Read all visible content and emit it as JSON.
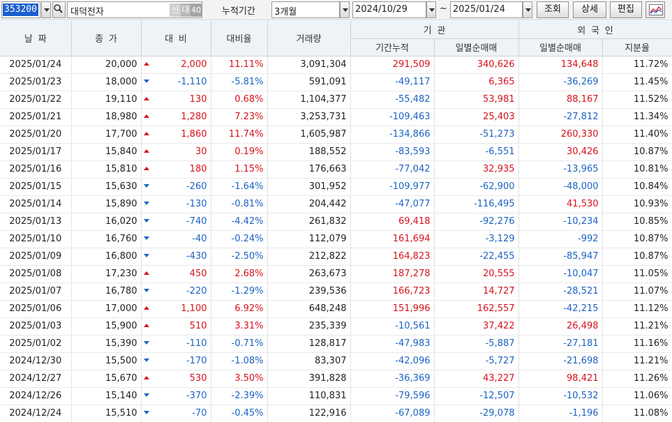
{
  "toolbar": {
    "stock_code": "353200",
    "stock_name": "대덕전자",
    "badge_shin": "신",
    "badge_dae": "대",
    "badge_num": "40",
    "period_label": "누적기간",
    "period_value": "3개월",
    "date_from": "2024/10/29",
    "tilde": "~",
    "date_to": "2025/01/24",
    "search_label": "조회",
    "detail_label": "상세",
    "edit_label": "편집",
    "icons": {
      "search": "magnifier-icon",
      "dropdown": "chevron-down-icon",
      "chart": "line-chart-icon"
    }
  },
  "headers": {
    "date": "날짜",
    "close": "종가",
    "change": "대비",
    "rate": "대비율",
    "volume": "거래량",
    "institution": "기관",
    "inst_cum": "기간누적",
    "inst_daily": "일별순매매",
    "foreign": "외국인",
    "for_daily": "일별순매매",
    "for_share": "지분율"
  },
  "colors": {
    "up": "#d6131c",
    "down": "#1c63c2",
    "header_bg": "#eef3f8",
    "selection": "#1a5fd0"
  },
  "rows": [
    {
      "date": "2025/01/24",
      "close": "20,000",
      "dir": "up",
      "change": "2,000",
      "rate": "11.11%",
      "volume": "3,091,304",
      "inst_cum": "291,509",
      "inst_daily": "340,626",
      "for_daily": "134,648",
      "share": "11.72%"
    },
    {
      "date": "2025/01/23",
      "close": "18,000",
      "dir": "down",
      "change": "-1,110",
      "rate": "-5.81%",
      "volume": "591,091",
      "inst_cum": "-49,117",
      "inst_daily": "6,365",
      "for_daily": "-36,269",
      "share": "11.45%"
    },
    {
      "date": "2025/01/22",
      "close": "19,110",
      "dir": "up",
      "change": "130",
      "rate": "0.68%",
      "volume": "1,104,377",
      "inst_cum": "-55,482",
      "inst_daily": "53,981",
      "for_daily": "88,167",
      "share": "11.52%"
    },
    {
      "date": "2025/01/21",
      "close": "18,980",
      "dir": "up",
      "change": "1,280",
      "rate": "7.23%",
      "volume": "3,253,731",
      "inst_cum": "-109,463",
      "inst_daily": "25,403",
      "for_daily": "-27,812",
      "share": "11.34%"
    },
    {
      "date": "2025/01/20",
      "close": "17,700",
      "dir": "up",
      "change": "1,860",
      "rate": "11.74%",
      "volume": "1,605,987",
      "inst_cum": "-134,866",
      "inst_daily": "-51,273",
      "for_daily": "260,330",
      "share": "11.40%"
    },
    {
      "date": "2025/01/17",
      "close": "15,840",
      "dir": "up",
      "change": "30",
      "rate": "0.19%",
      "volume": "188,552",
      "inst_cum": "-83,593",
      "inst_daily": "-6,551",
      "for_daily": "30,426",
      "share": "10.87%"
    },
    {
      "date": "2025/01/16",
      "close": "15,810",
      "dir": "up",
      "change": "180",
      "rate": "1.15%",
      "volume": "176,663",
      "inst_cum": "-77,042",
      "inst_daily": "32,935",
      "for_daily": "-13,965",
      "share": "10.81%"
    },
    {
      "date": "2025/01/15",
      "close": "15,630",
      "dir": "down",
      "change": "-260",
      "rate": "-1.64%",
      "volume": "301,952",
      "inst_cum": "-109,977",
      "inst_daily": "-62,900",
      "for_daily": "-48,000",
      "share": "10.84%"
    },
    {
      "date": "2025/01/14",
      "close": "15,890",
      "dir": "down",
      "change": "-130",
      "rate": "-0.81%",
      "volume": "204,442",
      "inst_cum": "-47,077",
      "inst_daily": "-116,495",
      "for_daily": "41,530",
      "share": "10.93%"
    },
    {
      "date": "2025/01/13",
      "close": "16,020",
      "dir": "down",
      "change": "-740",
      "rate": "-4.42%",
      "volume": "261,832",
      "inst_cum": "69,418",
      "inst_daily": "-92,276",
      "for_daily": "-10,234",
      "share": "10.85%"
    },
    {
      "date": "2025/01/10",
      "close": "16,760",
      "dir": "down",
      "change": "-40",
      "rate": "-0.24%",
      "volume": "112,079",
      "inst_cum": "161,694",
      "inst_daily": "-3,129",
      "for_daily": "-992",
      "share": "10.87%"
    },
    {
      "date": "2025/01/09",
      "close": "16,800",
      "dir": "down",
      "change": "-430",
      "rate": "-2.50%",
      "volume": "212,822",
      "inst_cum": "164,823",
      "inst_daily": "-22,455",
      "for_daily": "-85,947",
      "share": "10.87%"
    },
    {
      "date": "2025/01/08",
      "close": "17,230",
      "dir": "up",
      "change": "450",
      "rate": "2.68%",
      "volume": "263,673",
      "inst_cum": "187,278",
      "inst_daily": "20,555",
      "for_daily": "-10,047",
      "share": "11.05%"
    },
    {
      "date": "2025/01/07",
      "close": "16,780",
      "dir": "down",
      "change": "-220",
      "rate": "-1.29%",
      "volume": "239,536",
      "inst_cum": "166,723",
      "inst_daily": "14,727",
      "for_daily": "-28,521",
      "share": "11.07%"
    },
    {
      "date": "2025/01/06",
      "close": "17,000",
      "dir": "up",
      "change": "1,100",
      "rate": "6.92%",
      "volume": "648,248",
      "inst_cum": "151,996",
      "inst_daily": "162,557",
      "for_daily": "-42,215",
      "share": "11.12%"
    },
    {
      "date": "2025/01/03",
      "close": "15,900",
      "dir": "up",
      "change": "510",
      "rate": "3.31%",
      "volume": "235,339",
      "inst_cum": "-10,561",
      "inst_daily": "37,422",
      "for_daily": "26,498",
      "share": "11.21%"
    },
    {
      "date": "2025/01/02",
      "close": "15,390",
      "dir": "down",
      "change": "-110",
      "rate": "-0.71%",
      "volume": "128,817",
      "inst_cum": "-47,983",
      "inst_daily": "-5,887",
      "for_daily": "-27,181",
      "share": "11.16%"
    },
    {
      "date": "2024/12/30",
      "close": "15,500",
      "dir": "down",
      "change": "-170",
      "rate": "-1.08%",
      "volume": "83,307",
      "inst_cum": "-42,096",
      "inst_daily": "-5,727",
      "for_daily": "-21,698",
      "share": "11.21%"
    },
    {
      "date": "2024/12/27",
      "close": "15,670",
      "dir": "up",
      "change": "530",
      "rate": "3.50%",
      "volume": "391,828",
      "inst_cum": "-36,369",
      "inst_daily": "43,227",
      "for_daily": "98,421",
      "share": "11.26%"
    },
    {
      "date": "2024/12/26",
      "close": "15,140",
      "dir": "down",
      "change": "-370",
      "rate": "-2.39%",
      "volume": "110,831",
      "inst_cum": "-79,596",
      "inst_daily": "-12,507",
      "for_daily": "-10,532",
      "share": "11.06%"
    },
    {
      "date": "2024/12/24",
      "close": "15,510",
      "dir": "down",
      "change": "-70",
      "rate": "-0.45%",
      "volume": "122,916",
      "inst_cum": "-67,089",
      "inst_daily": "-29,078",
      "for_daily": "-1,196",
      "share": "11.08%"
    }
  ]
}
